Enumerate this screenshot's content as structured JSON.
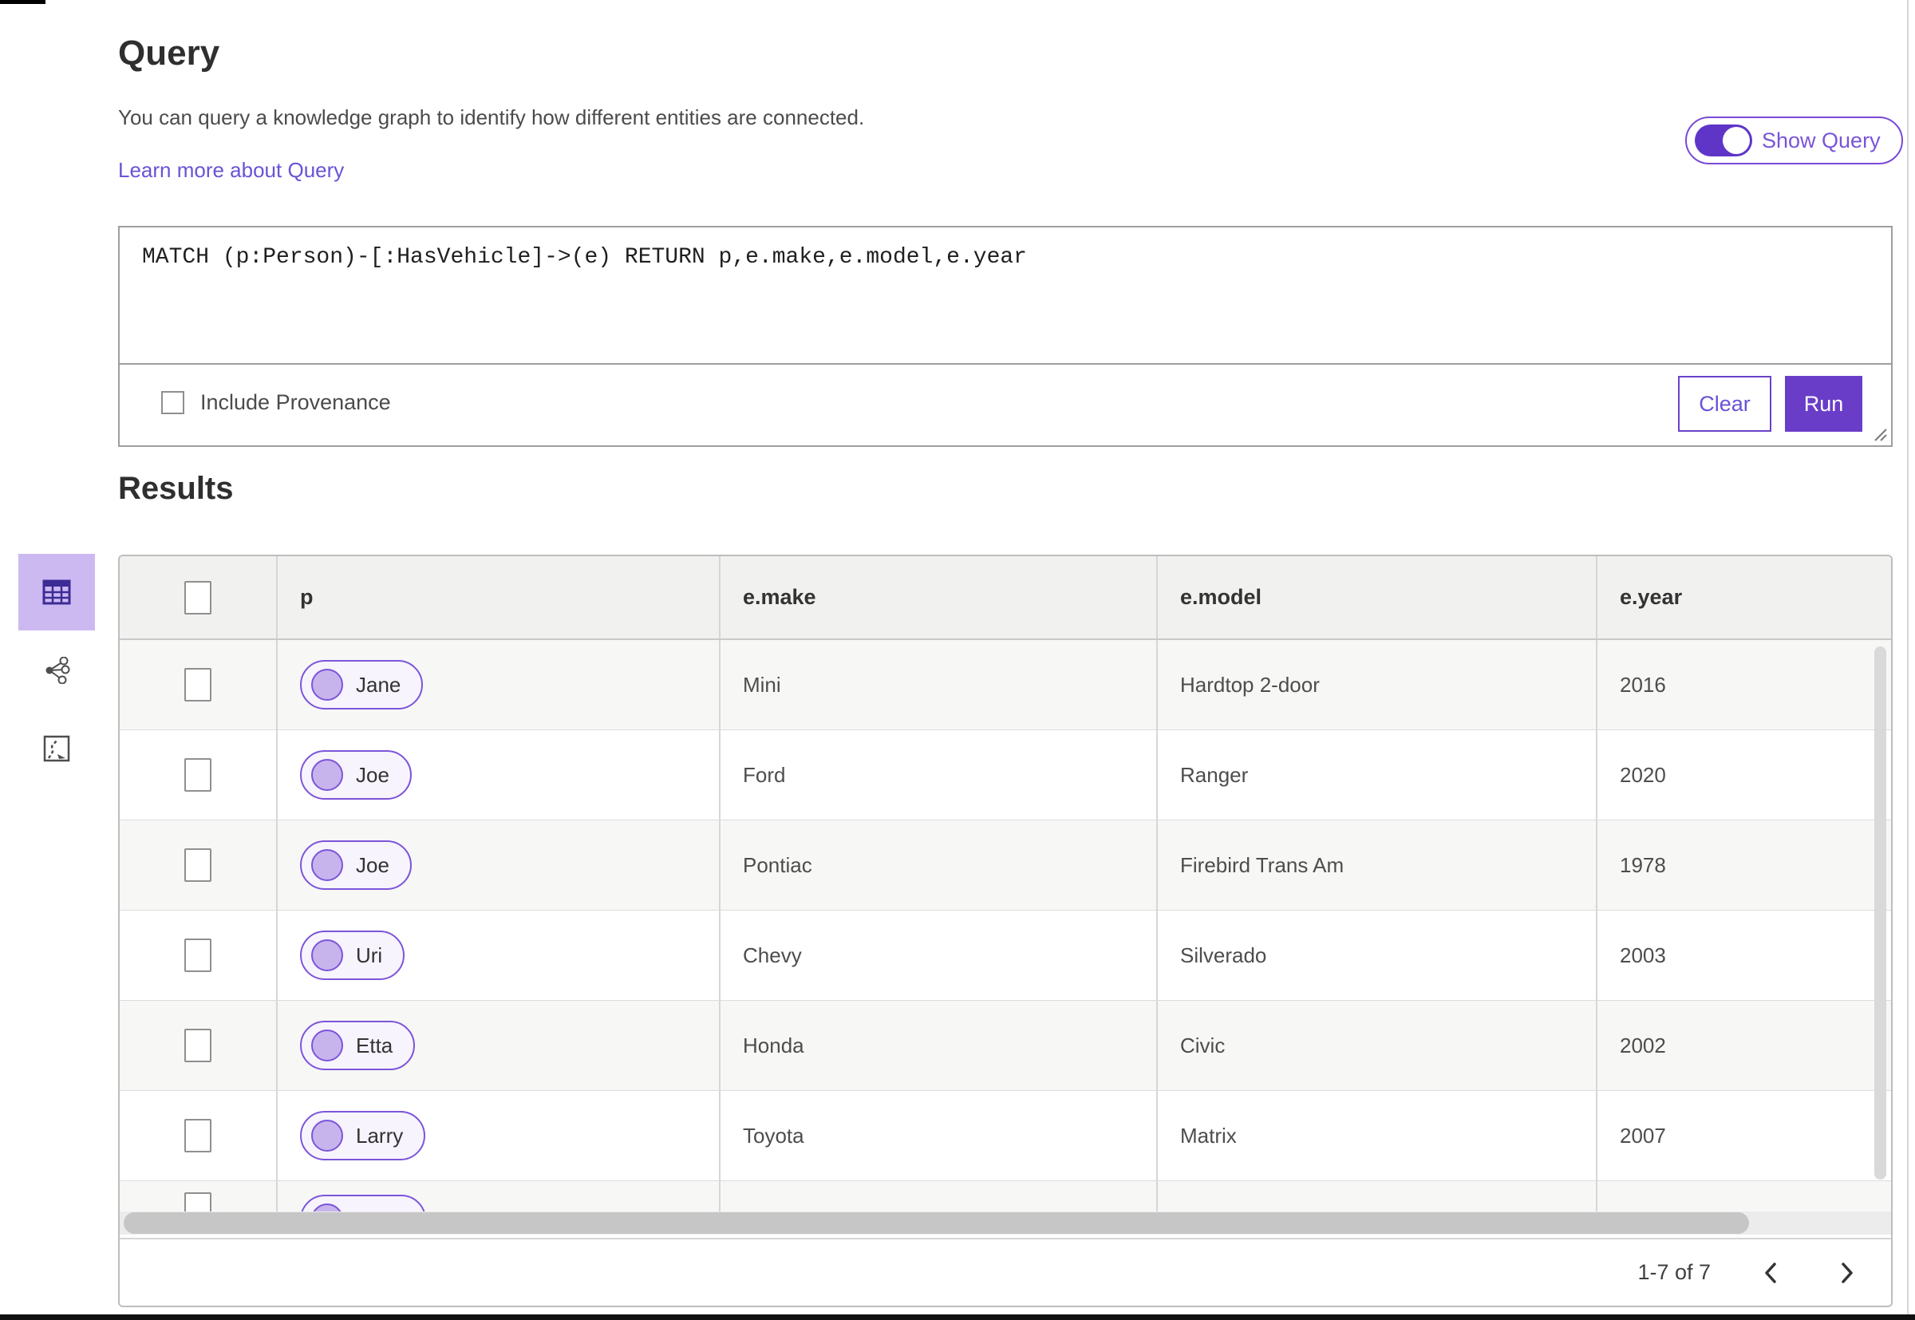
{
  "header": {
    "title": "Query",
    "description": "You can query a knowledge graph to identify how different entities are connected.",
    "learn_more_link": "Learn more about Query",
    "show_query_label": "Show Query",
    "show_query_on": true
  },
  "query_editor": {
    "query_text": "MATCH (p:Person)-[:HasVehicle]->(e) RETURN p,e.make,e.model,e.year",
    "include_provenance_label": "Include Provenance",
    "include_provenance_checked": false,
    "clear_button": "Clear",
    "run_button": "Run"
  },
  "results": {
    "heading": "Results",
    "view_tabs": [
      {
        "icon": "table-icon",
        "selected": true
      },
      {
        "icon": "link-chart-icon",
        "selected": false
      },
      {
        "icon": "map-icon",
        "selected": false
      }
    ],
    "columns": {
      "p": "p",
      "make": "e.make",
      "model": "e.model",
      "year": "e.year"
    },
    "rows": [
      {
        "p": "Jane",
        "make": "Mini",
        "model": "Hardtop 2-door",
        "year": "2016"
      },
      {
        "p": "Joe",
        "make": "Ford",
        "model": "Ranger",
        "year": "2020"
      },
      {
        "p": "Joe",
        "make": "Pontiac",
        "model": "Firebird Trans Am",
        "year": "1978"
      },
      {
        "p": "Uri",
        "make": "Chevy",
        "model": "Silverado",
        "year": "2003"
      },
      {
        "p": "Etta",
        "make": "Honda",
        "model": "Civic",
        "year": "2002"
      },
      {
        "p": "Larry",
        "make": "Toyota",
        "model": "Matrix",
        "year": "2007"
      }
    ],
    "pagination": {
      "range_label": "1-7 of 7"
    }
  },
  "colors": {
    "accent_purple": "#6a3dc8",
    "link_purple": "#6a52d6",
    "chip_border": "#7c55d9",
    "chip_fill": "#f7f4fd",
    "selected_tab_bg": "#cdb9f2"
  }
}
